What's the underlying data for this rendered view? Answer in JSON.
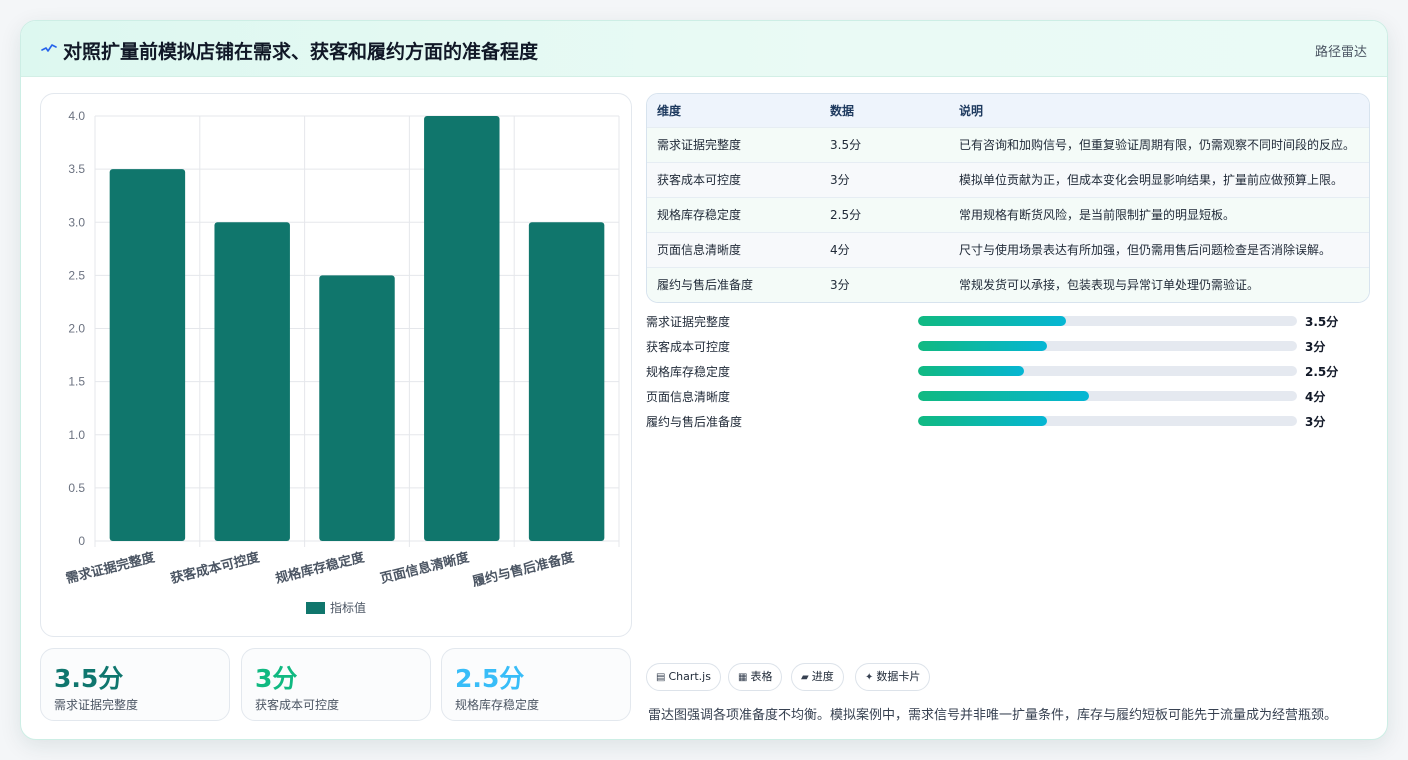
{
  "header": {
    "title": "对照扩量前模拟店铺在需求、获客和履约方面的准备程度",
    "tag": "路径雷达",
    "icon": "sparkline-icon"
  },
  "chart_data": {
    "type": "bar",
    "categories": [
      "需求证据完整度",
      "获客成本可控度",
      "规格库存稳定度",
      "页面信息清晰度",
      "履约与售后准备度"
    ],
    "series": [
      {
        "name": "指标值",
        "values": [
          3.5,
          3,
          2.5,
          4,
          3
        ],
        "color": "#10766c"
      }
    ],
    "ylim": [
      0,
      4
    ],
    "yticks": [
      "0",
      "0.5",
      "1.0",
      "1.5",
      "2.0",
      "2.5",
      "3.0",
      "3.5",
      "4.0"
    ],
    "grid": true,
    "legend": "bottom"
  },
  "stats": [
    {
      "value": "3.5分",
      "label": "需求证据完整度",
      "color": "#0f766e"
    },
    {
      "value": "3分",
      "label": "获客成本可控度",
      "color": "#10b981"
    },
    {
      "value": "2.5分",
      "label": "规格库存稳定度",
      "color": "#38bdf8"
    }
  ],
  "table": {
    "headers": [
      "维度",
      "数据",
      "说明"
    ],
    "rows": [
      [
        "需求证据完整度",
        "3.5分",
        "已有咨询和加购信号，但重复验证周期有限，仍需观察不同时间段的反应。"
      ],
      [
        "获客成本可控度",
        "3分",
        "模拟单位贡献为正，但成本变化会明显影响结果，扩量前应做预算上限。"
      ],
      [
        "规格库存稳定度",
        "2.5分",
        "常用规格有断货风险，是当前限制扩量的明显短板。"
      ],
      [
        "页面信息清晰度",
        "4分",
        "尺寸与使用场景表达有所加强，但仍需用售后问题检查是否消除误解。"
      ],
      [
        "履约与售后准备度",
        "3分",
        "常规发货可以承接，包装表现与异常订单处理仍需验证。"
      ]
    ]
  },
  "progress": [
    {
      "label": "需求证据完整度",
      "value": "3.5分",
      "fraction": 0.39
    },
    {
      "label": "获客成本可控度",
      "value": "3分",
      "fraction": 0.34
    },
    {
      "label": "规格库存稳定度",
      "value": "2.5分",
      "fraction": 0.28
    },
    {
      "label": "页面信息清晰度",
      "value": "4分",
      "fraction": 0.45
    },
    {
      "label": "履约与售后准备度",
      "value": "3分",
      "fraction": 0.34
    }
  ],
  "chips": [
    {
      "label": "Chart.js",
      "icon": "chart-icon"
    },
    {
      "label": "表格",
      "icon": "table-icon"
    },
    {
      "label": "进度",
      "icon": "progress-icon"
    },
    {
      "label": "数据卡片",
      "icon": "sparkle-icon"
    }
  ],
  "note": "雷达图强调各项准备度不均衡。模拟案例中，需求信号并非唯一扩量条件，库存与履约短板可能先于流量成为经营瓶颈。"
}
